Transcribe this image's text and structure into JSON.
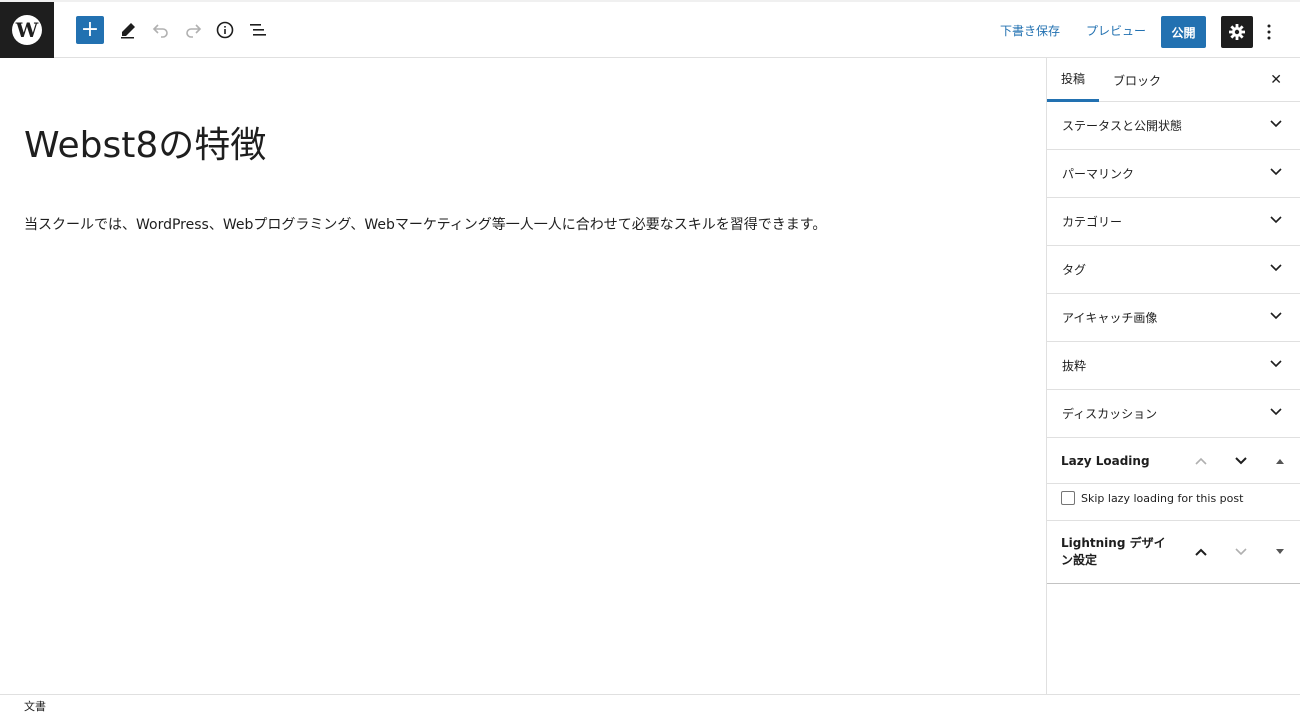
{
  "toolbar": {
    "logo_letter": "W",
    "add_label": "+",
    "save_draft": "下書き保存",
    "preview": "プレビュー",
    "publish": "公開"
  },
  "editor": {
    "title": "Webst8の特徴",
    "paragraph": "当スクールでは、WordPress、Webプログラミング、Webマーケティング等一人一人に合わせて必要なスキルを習得できます。"
  },
  "sidebar": {
    "tabs": {
      "post": "投稿",
      "block": "ブロック"
    },
    "close": "✕",
    "panels": [
      "ステータスと公開状態",
      "パーマリンク",
      "カテゴリー",
      "タグ",
      "アイキャッチ画像",
      "抜粋",
      "ディスカッション"
    ],
    "lazy_loading": {
      "title": "Lazy Loading",
      "checkbox_label": "Skip lazy loading for this post"
    },
    "lightning": {
      "title": "Lightning デザイン設定"
    }
  },
  "footer": {
    "breadcrumb": "文書"
  }
}
